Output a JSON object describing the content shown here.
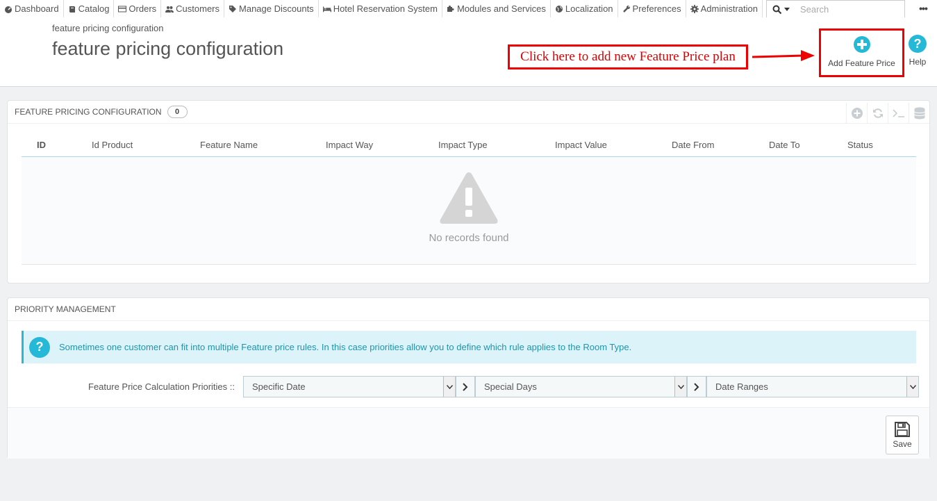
{
  "nav": {
    "items": [
      {
        "label": "Dashboard",
        "icon": "dashboard-icon"
      },
      {
        "label": "Catalog",
        "icon": "book-icon"
      },
      {
        "label": "Orders",
        "icon": "credit-card-icon"
      },
      {
        "label": "Customers",
        "icon": "users-icon"
      },
      {
        "label": "Manage Discounts",
        "icon": "tags-icon"
      },
      {
        "label": "Hotel Reservation System",
        "icon": "bed-icon"
      },
      {
        "label": "Modules and Services",
        "icon": "puzzle-icon"
      },
      {
        "label": "Localization",
        "icon": "globe-icon"
      },
      {
        "label": "Preferences",
        "icon": "wrench-icon"
      },
      {
        "label": "Administration",
        "icon": "cog-icon"
      }
    ],
    "search_placeholder": "Search",
    "more": "•••"
  },
  "header": {
    "breadcrumb": "feature pricing configuration",
    "title": "feature pricing configuration",
    "annotation": "Click here to add new Feature Price plan",
    "add_label": "Add Feature Price",
    "help_label": "Help"
  },
  "list_panel": {
    "title": "FEATURE PRICING CONFIGURATION",
    "count": "0",
    "columns": [
      "ID",
      "Id Product",
      "Feature Name",
      "Impact Way",
      "Impact Type",
      "Impact Value",
      "Date From",
      "Date To",
      "Status"
    ],
    "empty_text": "No records found"
  },
  "priority_panel": {
    "title": "PRIORITY MANAGEMENT",
    "info": "Sometimes one customer can fit into multiple Feature price rules. In this case priorities allow you to define which rule applies to the Room Type.",
    "label": "Feature Price Calculation Priorities ::",
    "selects": [
      "Specific Date",
      "Special Days",
      "Date Ranges"
    ],
    "save_label": "Save"
  },
  "colors": {
    "accent": "#25b9d7",
    "annotation_red": "#e00000"
  }
}
